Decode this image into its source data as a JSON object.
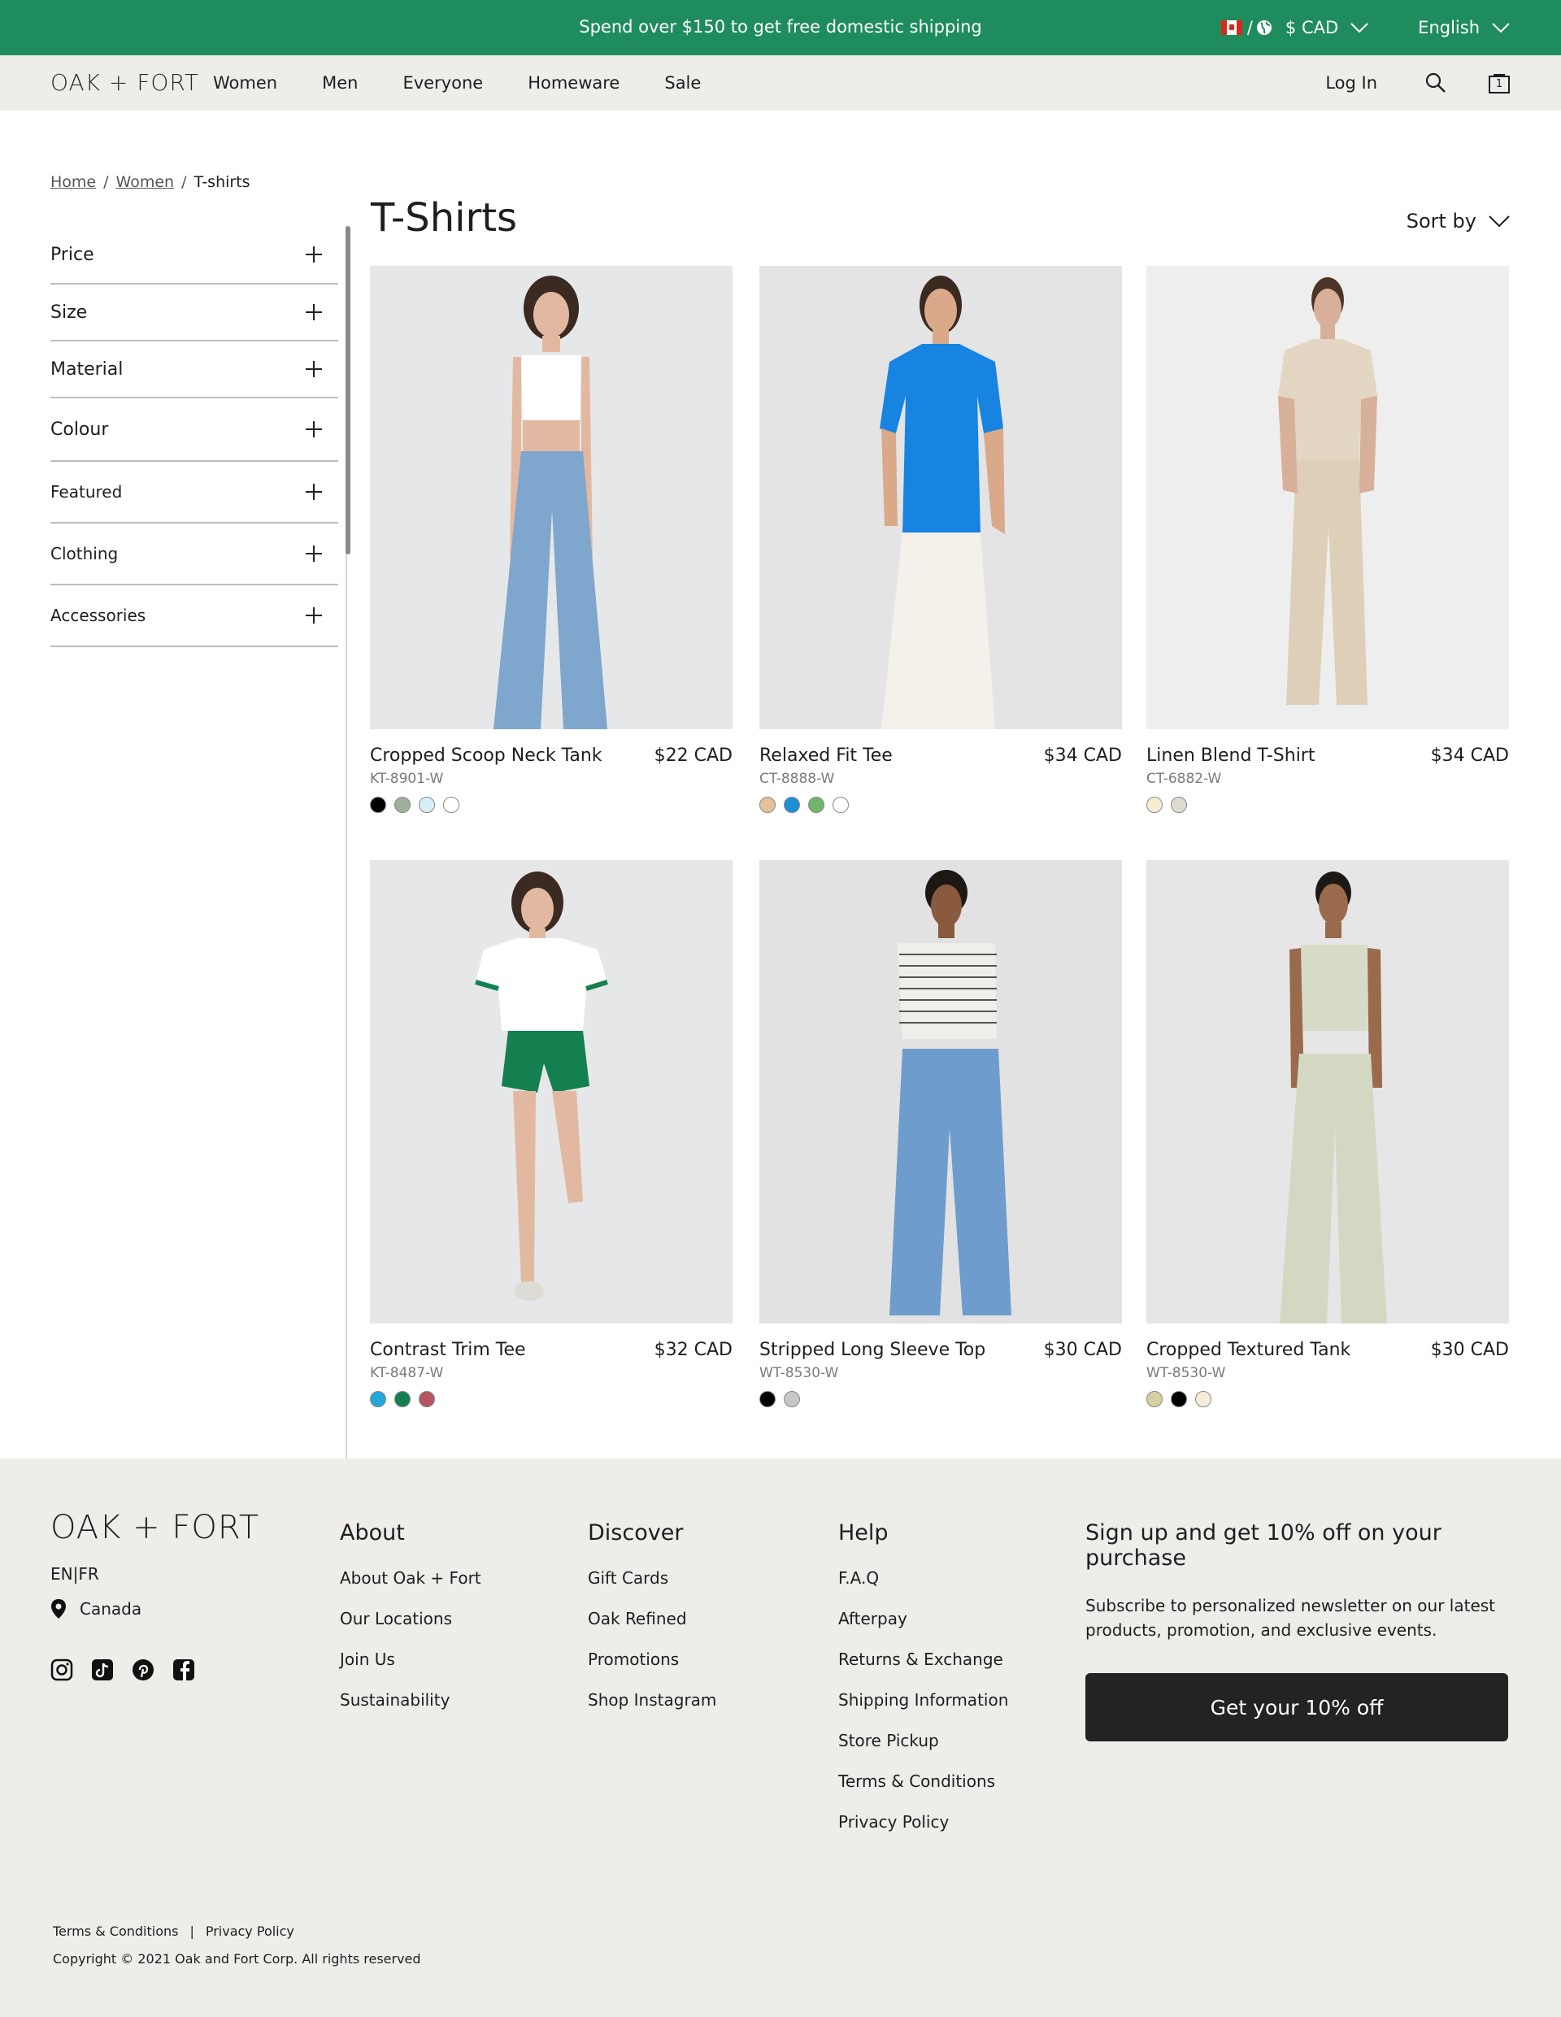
{
  "promo": {
    "text": "Spend over $150 to get free domestic shipping",
    "slash": "/",
    "currency": "$ CAD",
    "language": "English"
  },
  "header": {
    "logo": "OAK + FORT",
    "nav": [
      "Women",
      "Men",
      "Everyone",
      "Homeware",
      "Sale"
    ],
    "login": "Log In",
    "cart_count": "1"
  },
  "breadcrumb": {
    "home": "Home",
    "women": "Women",
    "current": "T-shirts",
    "sep": "/"
  },
  "filters": [
    "Price",
    "Size",
    "Material",
    "Colour",
    "Featured",
    "Clothing",
    "Accessories"
  ],
  "page": {
    "title": "T-Shirts",
    "sort": "Sort by"
  },
  "products": [
    {
      "name": "Cropped Scoop Neck Tank",
      "price": "$22 CAD",
      "sku": "KT-8901-W",
      "swatches": [
        "#000000",
        "#9fb09c",
        "#d8eef6",
        "#ffffff"
      ]
    },
    {
      "name": "Relaxed Fit Tee",
      "price": "$34 CAD",
      "sku": "CT-8888-W",
      "swatches": [
        "#e5c09b",
        "#1e8fd6",
        "#6fb56a",
        "#ffffff"
      ]
    },
    {
      "name": "Linen Blend T-Shirt",
      "price": "$34 CAD",
      "sku": "CT-6882-W",
      "swatches": [
        "#f6edd4",
        "#dedcd2"
      ]
    },
    {
      "name": "Contrast Trim Tee",
      "price": "$32 CAD",
      "sku": "KT-8487-W",
      "swatches": [
        "#23a9d8",
        "#14804f",
        "#b4565f"
      ]
    },
    {
      "name": "Stripped Long Sleeve Top",
      "price": "$30 CAD",
      "sku": "WT-8530-W",
      "swatches": [
        "#000000",
        "#c7c7c7"
      ]
    },
    {
      "name": "Cropped Textured Tank",
      "price": "$30 CAD",
      "sku": "WT-8530-W",
      "swatches": [
        "#d6cfa0",
        "#000000",
        "#f7ecd8"
      ]
    }
  ],
  "footer": {
    "logo": "OAK + FORT",
    "lang": "EN|FR",
    "location": "Canada",
    "about": {
      "heading": "About",
      "links": [
        "About Oak + Fort",
        "Our Locations",
        "Join Us",
        "Sustainability"
      ]
    },
    "discover": {
      "heading": "Discover",
      "links": [
        "Gift Cards",
        "Oak Refined",
        "Promotions",
        "Shop Instagram"
      ]
    },
    "help": {
      "heading": "Help",
      "links": [
        "F.A.Q",
        "Afterpay",
        "Returns & Exchange",
        "Shipping Information",
        "Store Pickup",
        "Terms & Conditions",
        "Privacy Policy"
      ]
    },
    "newsletter": {
      "heading": "Sign up and get 10% off on your purchase",
      "text": "Subscribe to personalized newsletter on our latest products, promotion, and exclusive events.",
      "cta": "Get your 10% off"
    },
    "legal_terms": "Terms & Conditions",
    "legal_sep": "|",
    "legal_privacy": "Privacy Policy",
    "copyright": "Copyright © 2021 Oak and Fort Corp. All rights reserved"
  },
  "colors": {
    "promo_bg": "#1f8c5e",
    "header_bg": "#eeedea",
    "cta_bg": "#232323"
  },
  "icons": [
    "canada-flag-icon",
    "globe-icon",
    "chevron-down-icon",
    "search-icon",
    "bag-icon",
    "plus-icon",
    "location-pin-icon",
    "instagram-icon",
    "tiktok-icon",
    "pinterest-icon",
    "facebook-icon"
  ]
}
